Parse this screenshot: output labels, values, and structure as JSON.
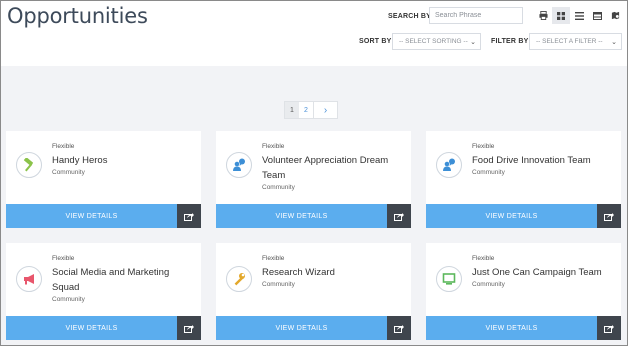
{
  "page": {
    "title": "Opportunities"
  },
  "toolbar": {
    "search_label": "SEARCH BY",
    "search_placeholder": "Search Phrase",
    "sort_label": "SORT BY",
    "sort_value": "-- SELECT SORTING --",
    "filter_label": "FILTER BY",
    "filter_value": "-- SELECT A FILTER --",
    "views": [
      "print-icon",
      "grid-view-icon",
      "list-view-icon",
      "table-view-icon",
      "map-view-icon"
    ],
    "active_view": "grid-view-icon"
  },
  "pagination": {
    "pages": [
      "1",
      "2"
    ],
    "current": "1",
    "next": "›"
  },
  "cards": [
    {
      "availability": "Flexible",
      "name": "Handy Heros",
      "category": "Community",
      "icon": "hammer-icon",
      "icon_color": "#8bc34a",
      "button": "VIEW DETAILS"
    },
    {
      "availability": "Flexible",
      "name": "Volunteer Appreciation Dream Team",
      "category": "Community",
      "icon": "user-chat-icon",
      "icon_color": "#3d8fd6",
      "button": "VIEW DETAILS"
    },
    {
      "availability": "Flexible",
      "name": "Food Drive Innovation Team",
      "category": "Community",
      "icon": "user-chat-icon",
      "icon_color": "#3d8fd6",
      "button": "VIEW DETAILS"
    },
    {
      "availability": "Flexible",
      "name": "Social Media and Marketing Squad",
      "category": "Community",
      "icon": "megaphone-icon",
      "icon_color": "#e8566c",
      "button": "VIEW DETAILS"
    },
    {
      "availability": "Flexible",
      "name": "Research Wizard",
      "category": "Community",
      "icon": "wrench-icon",
      "icon_color": "#e3a82b",
      "button": "VIEW DETAILS"
    },
    {
      "availability": "Flexible",
      "name": "Just One Can Campaign Team",
      "category": "Community",
      "icon": "monitor-icon",
      "icon_color": "#5cb85c",
      "button": "VIEW DETAILS"
    }
  ]
}
